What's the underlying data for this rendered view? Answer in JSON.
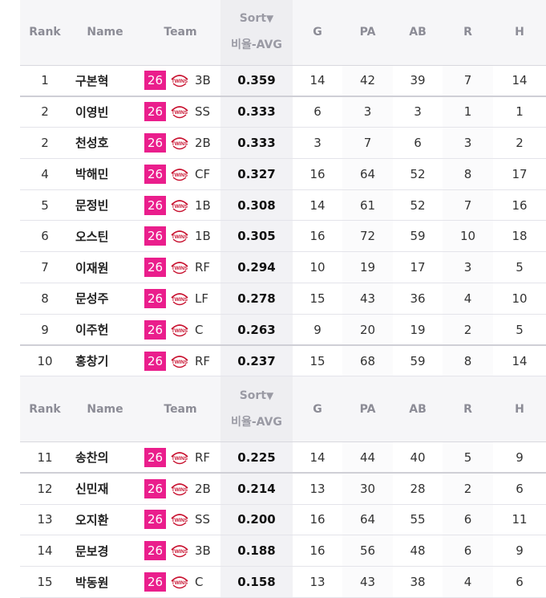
{
  "colors": {
    "team_badge": "#ea1e8c",
    "logo_red": "#c8102e"
  },
  "headers": {
    "rank": "Rank",
    "name": "Name",
    "team": "Team",
    "sort": "Sort",
    "sort_icon": "▼",
    "avg": "비율-AVG",
    "g": "G",
    "pa": "PA",
    "ab": "AB",
    "r": "R",
    "h": "H"
  },
  "logo_text": "TWINS",
  "groups": [
    {
      "rows": [
        {
          "rank": "1",
          "name": "구본혁",
          "num": "26",
          "pos": "3B",
          "avg": "0.359",
          "g": "14",
          "pa": "42",
          "ab": "39",
          "r": "7",
          "h": "14"
        },
        {
          "rank": "2",
          "name": "이영빈",
          "num": "26",
          "pos": "SS",
          "avg": "0.333",
          "g": "6",
          "pa": "3",
          "ab": "3",
          "r": "1",
          "h": "1"
        },
        {
          "rank": "2",
          "name": "천성호",
          "num": "26",
          "pos": "2B",
          "avg": "0.333",
          "g": "3",
          "pa": "7",
          "ab": "6",
          "r": "3",
          "h": "2"
        },
        {
          "rank": "4",
          "name": "박해민",
          "num": "26",
          "pos": "CF",
          "avg": "0.327",
          "g": "16",
          "pa": "64",
          "ab": "52",
          "r": "8",
          "h": "17"
        },
        {
          "rank": "5",
          "name": "문정빈",
          "num": "26",
          "pos": "1B",
          "avg": "0.308",
          "g": "14",
          "pa": "61",
          "ab": "52",
          "r": "7",
          "h": "16"
        },
        {
          "rank": "6",
          "name": "오스틴",
          "num": "26",
          "pos": "1B",
          "avg": "0.305",
          "g": "16",
          "pa": "72",
          "ab": "59",
          "r": "10",
          "h": "18"
        },
        {
          "rank": "7",
          "name": "이재원",
          "num": "26",
          "pos": "RF",
          "avg": "0.294",
          "g": "10",
          "pa": "19",
          "ab": "17",
          "r": "3",
          "h": "5"
        },
        {
          "rank": "8",
          "name": "문성주",
          "num": "26",
          "pos": "LF",
          "avg": "0.278",
          "g": "15",
          "pa": "43",
          "ab": "36",
          "r": "4",
          "h": "10"
        },
        {
          "rank": "9",
          "name": "이주헌",
          "num": "26",
          "pos": "C",
          "avg": "0.263",
          "g": "9",
          "pa": "20",
          "ab": "19",
          "r": "2",
          "h": "5"
        },
        {
          "rank": "10",
          "name": "홍창기",
          "num": "26",
          "pos": "RF",
          "avg": "0.237",
          "g": "15",
          "pa": "68",
          "ab": "59",
          "r": "8",
          "h": "14"
        }
      ]
    },
    {
      "rows": [
        {
          "rank": "11",
          "name": "송찬의",
          "num": "26",
          "pos": "RF",
          "avg": "0.225",
          "g": "14",
          "pa": "44",
          "ab": "40",
          "r": "5",
          "h": "9"
        },
        {
          "rank": "12",
          "name": "신민재",
          "num": "26",
          "pos": "2B",
          "avg": "0.214",
          "g": "13",
          "pa": "30",
          "ab": "28",
          "r": "2",
          "h": "6"
        },
        {
          "rank": "13",
          "name": "오지환",
          "num": "26",
          "pos": "SS",
          "avg": "0.200",
          "g": "16",
          "pa": "64",
          "ab": "55",
          "r": "6",
          "h": "11"
        },
        {
          "rank": "14",
          "name": "문보경",
          "num": "26",
          "pos": "3B",
          "avg": "0.188",
          "g": "16",
          "pa": "56",
          "ab": "48",
          "r": "6",
          "h": "9"
        },
        {
          "rank": "15",
          "name": "박동원",
          "num": "26",
          "pos": "C",
          "avg": "0.158",
          "g": "13",
          "pa": "43",
          "ab": "38",
          "r": "4",
          "h": "6"
        }
      ]
    }
  ]
}
